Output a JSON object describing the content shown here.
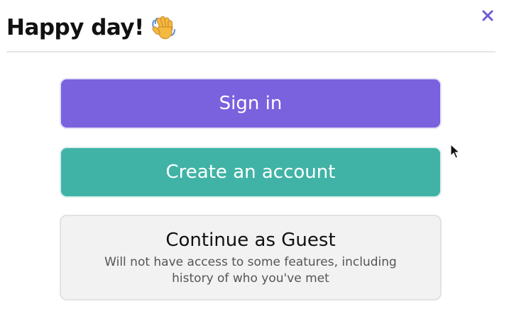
{
  "dialog": {
    "title": "Happy day!",
    "title_emoji_icon": "waving-hand-icon",
    "close_icon": "close-icon"
  },
  "buttons": {
    "signin_label": "Sign in",
    "create_label": "Create an account",
    "guest_label": "Continue as Guest",
    "guest_sublabel": "Will not have access to some features, including history of who you've met"
  },
  "colors": {
    "accent_purple": "#7a61de",
    "accent_teal": "#40b3a6",
    "guest_bg": "#f2f2f2",
    "close_color": "#6b5bd6"
  },
  "cursor_icon": "mouse-pointer-icon"
}
